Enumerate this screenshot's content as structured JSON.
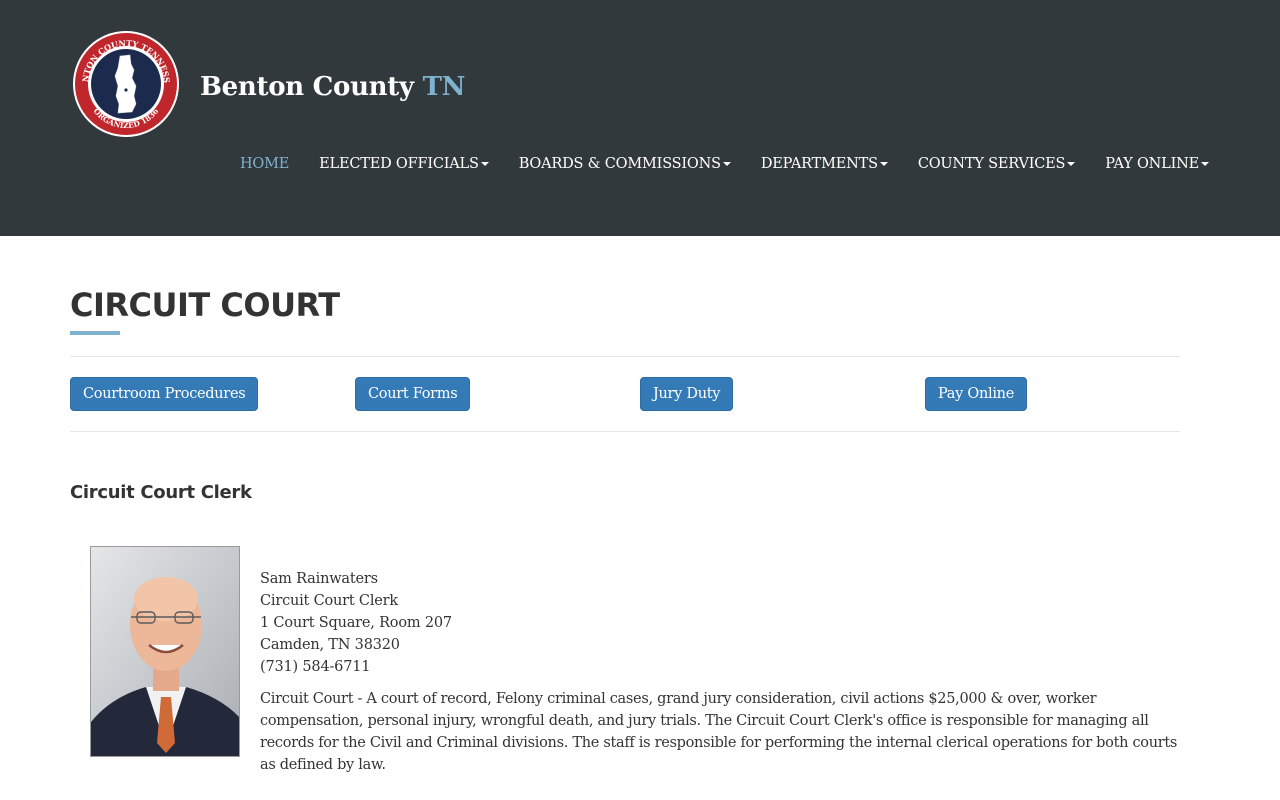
{
  "site": {
    "brand_main": "Benton County",
    "brand_accent": "TN",
    "seal_top_text": "BENTON COUNTY TENNESSEE",
    "seal_bottom_text": "ORGANIZED 1836"
  },
  "nav": {
    "items": [
      {
        "label": "HOME",
        "dropdown": false,
        "active": true
      },
      {
        "label": "ELECTED OFFICIALS",
        "dropdown": true,
        "active": false
      },
      {
        "label": "BOARDS & COMMISSIONS",
        "dropdown": true,
        "active": false
      },
      {
        "label": "DEPARTMENTS",
        "dropdown": true,
        "active": false
      },
      {
        "label": "COUNTY SERVICES",
        "dropdown": true,
        "active": false
      },
      {
        "label": "PAY ONLINE",
        "dropdown": true,
        "active": false
      }
    ]
  },
  "page": {
    "title": "CIRCUIT COURT"
  },
  "buttons": [
    {
      "label": "Courtroom Procedures"
    },
    {
      "label": "Court Forms"
    },
    {
      "label": "Jury Duty"
    },
    {
      "label": "Pay Online"
    }
  ],
  "clerk": {
    "section_heading": "Circuit Court Clerk",
    "name": "Sam Rainwaters",
    "role": "Circuit Court Clerk",
    "address1": "1 Court Square, Room 207",
    "address2": "Camden, TN 38320",
    "phone": "(731) 584-6711",
    "description": "Circuit Court - A court of record, Felony criminal cases, grand jury consideration, civil actions $25,000 & over, worker compensation, personal injury, wrongful death, and jury trials. The Circuit Court Clerk's office is responsible for managing all records for the Civil and Criminal divisions. The staff is responsible for performing the internal clerical operations for both courts as defined by law."
  },
  "colors": {
    "header_bg": "#32393d",
    "accent": "#7fb2cf",
    "button_bg": "#337ab7",
    "seal_ring": "#c0272d",
    "seal_center": "#1c2a4d"
  }
}
